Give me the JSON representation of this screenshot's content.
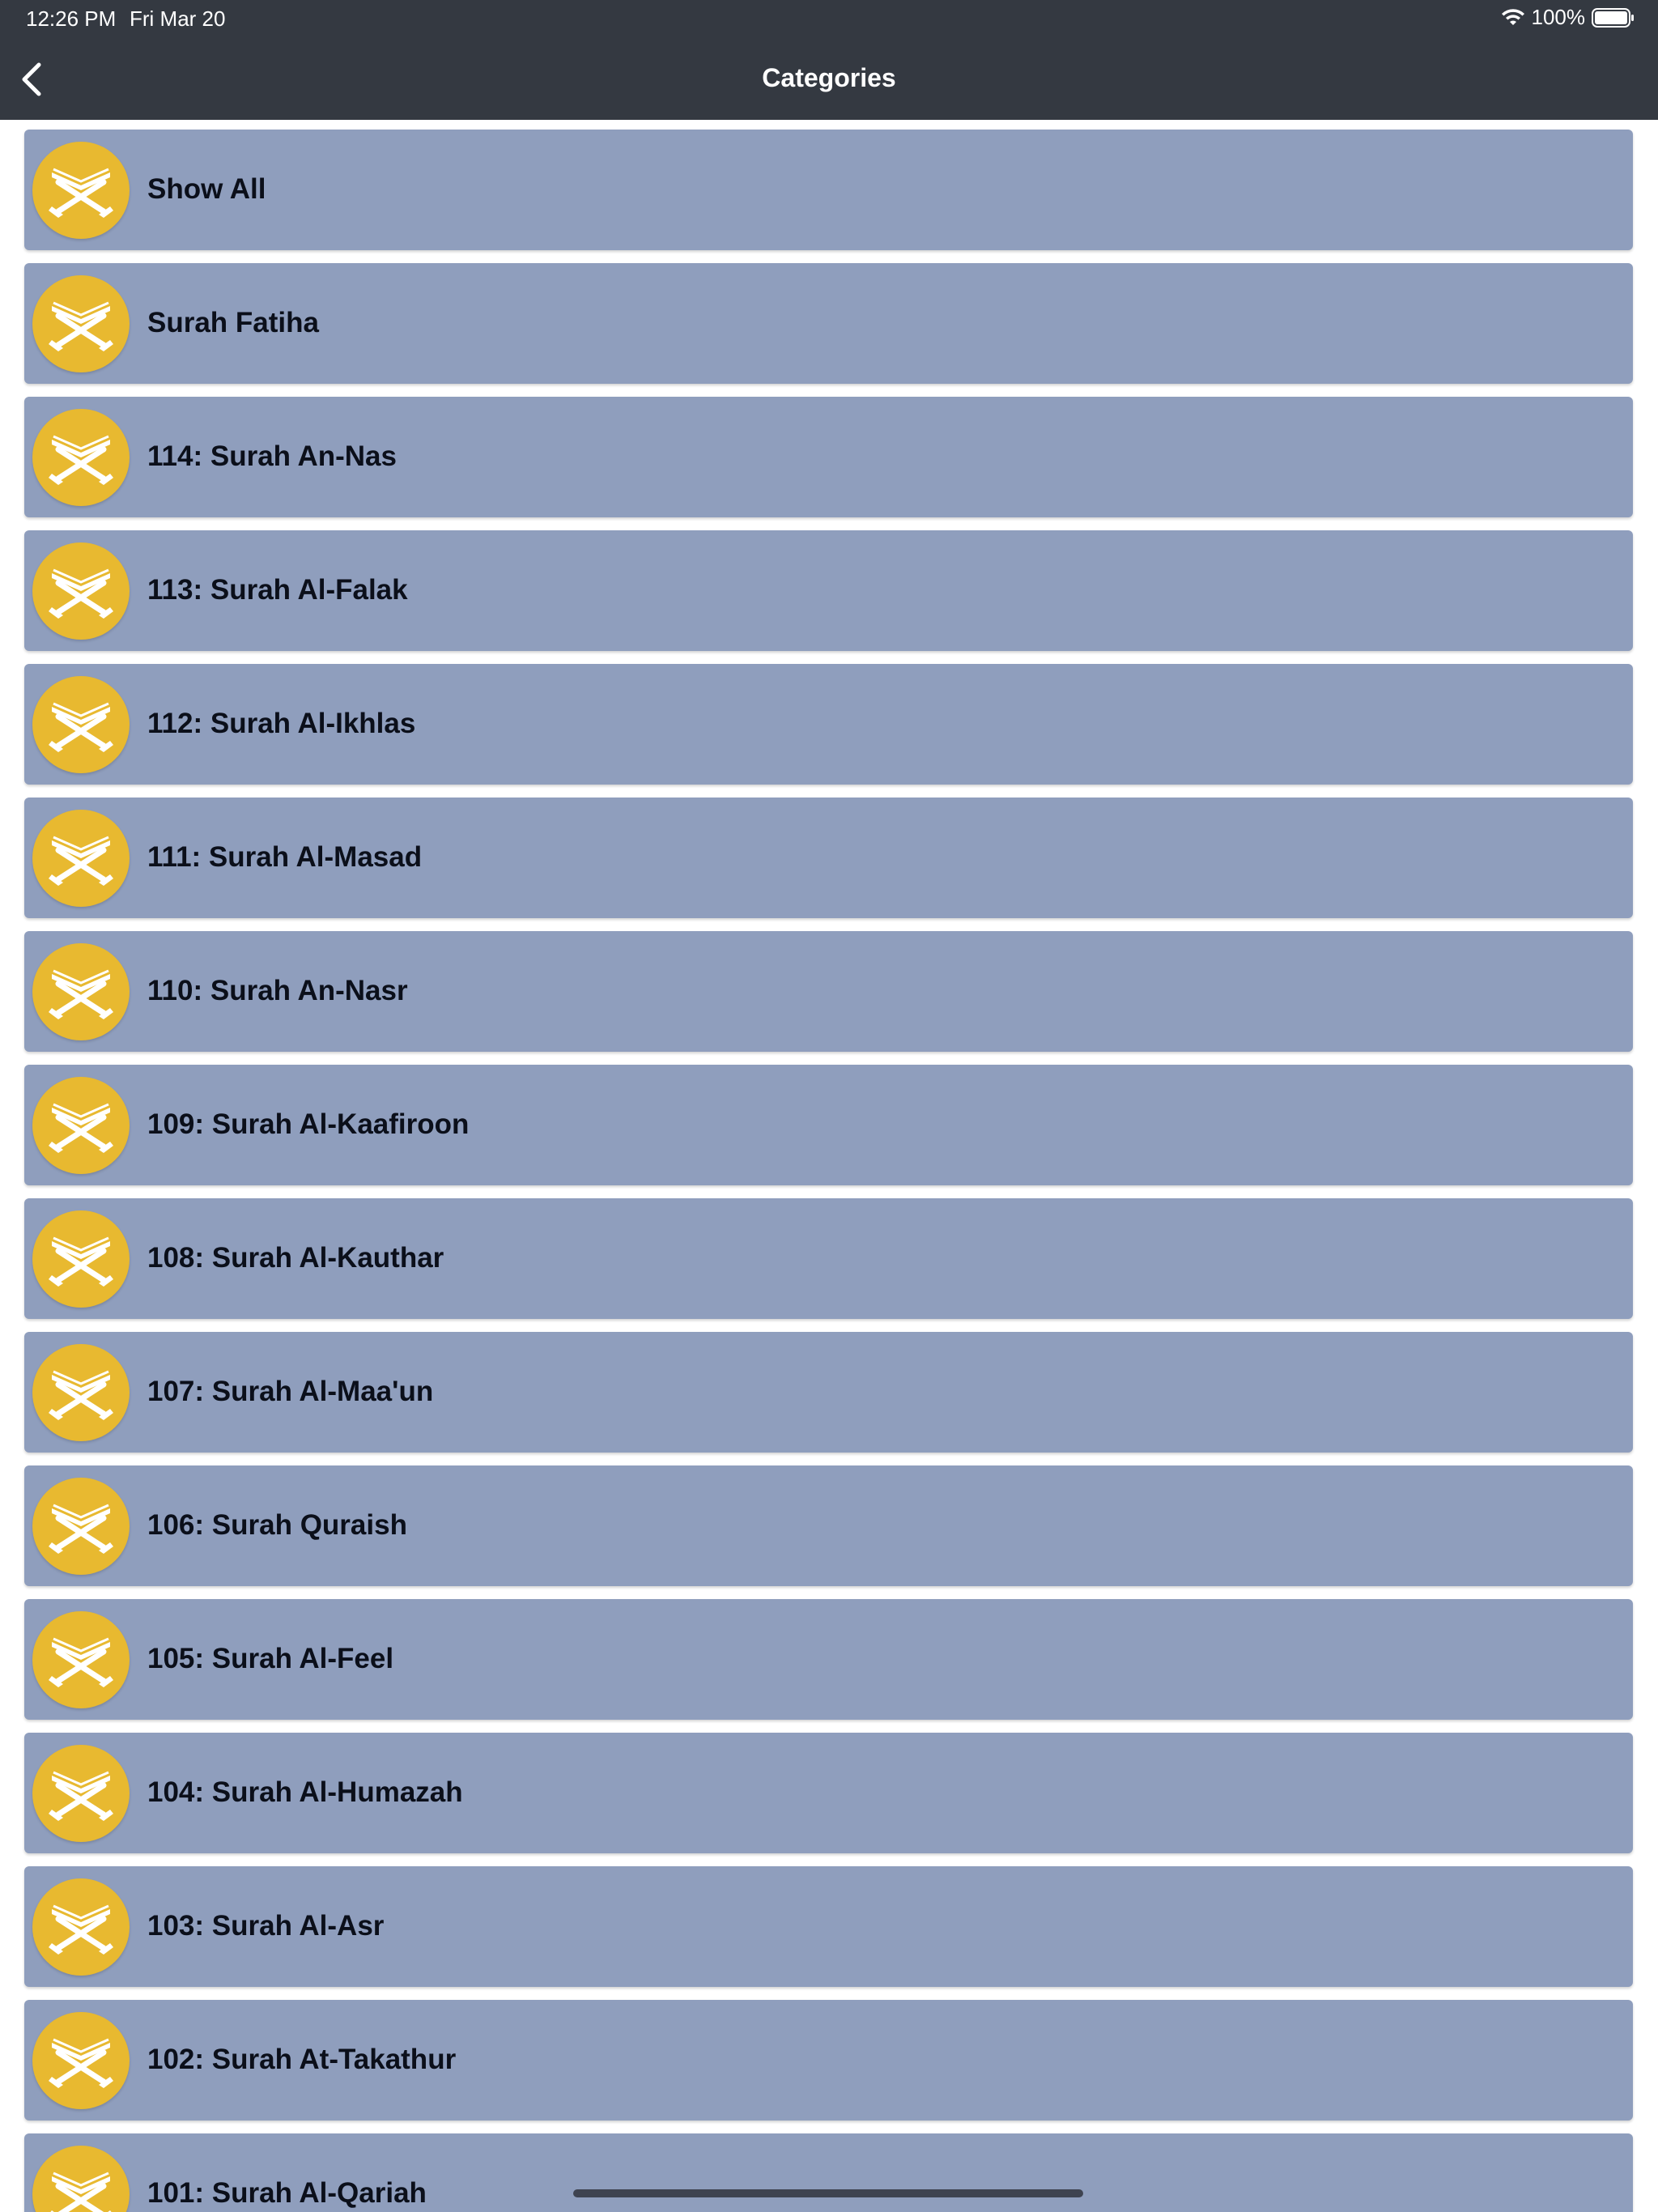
{
  "status_bar": {
    "time": "12:26 PM",
    "date": "Fri Mar 20",
    "battery": "100%"
  },
  "nav": {
    "title": "Categories",
    "back_icon": "chevron-left-icon"
  },
  "colors": {
    "bar_background": "#343941",
    "item_background": "#8f9ebd",
    "icon_background": "#e8b930"
  },
  "items": [
    {
      "label": "Show All"
    },
    {
      "label": "Surah Fatiha"
    },
    {
      "label": "114: Surah An-Nas"
    },
    {
      "label": "113: Surah Al-Falak"
    },
    {
      "label": "112: Surah Al-Ikhlas"
    },
    {
      "label": "111: Surah Al-Masad"
    },
    {
      "label": "110: Surah An-Nasr"
    },
    {
      "label": "109: Surah Al-Kaafiroon"
    },
    {
      "label": "108: Surah Al-Kauthar"
    },
    {
      "label": "107: Surah Al-Maa'un"
    },
    {
      "label": "106: Surah Quraish"
    },
    {
      "label": "105: Surah Al-Feel"
    },
    {
      "label": "104: Surah Al-Humazah"
    },
    {
      "label": "103: Surah Al-Asr"
    },
    {
      "label": "102: Surah At-Takathur"
    },
    {
      "label": "101: Surah Al-Qariah"
    }
  ],
  "item_icon": "open-book-stand-icon"
}
